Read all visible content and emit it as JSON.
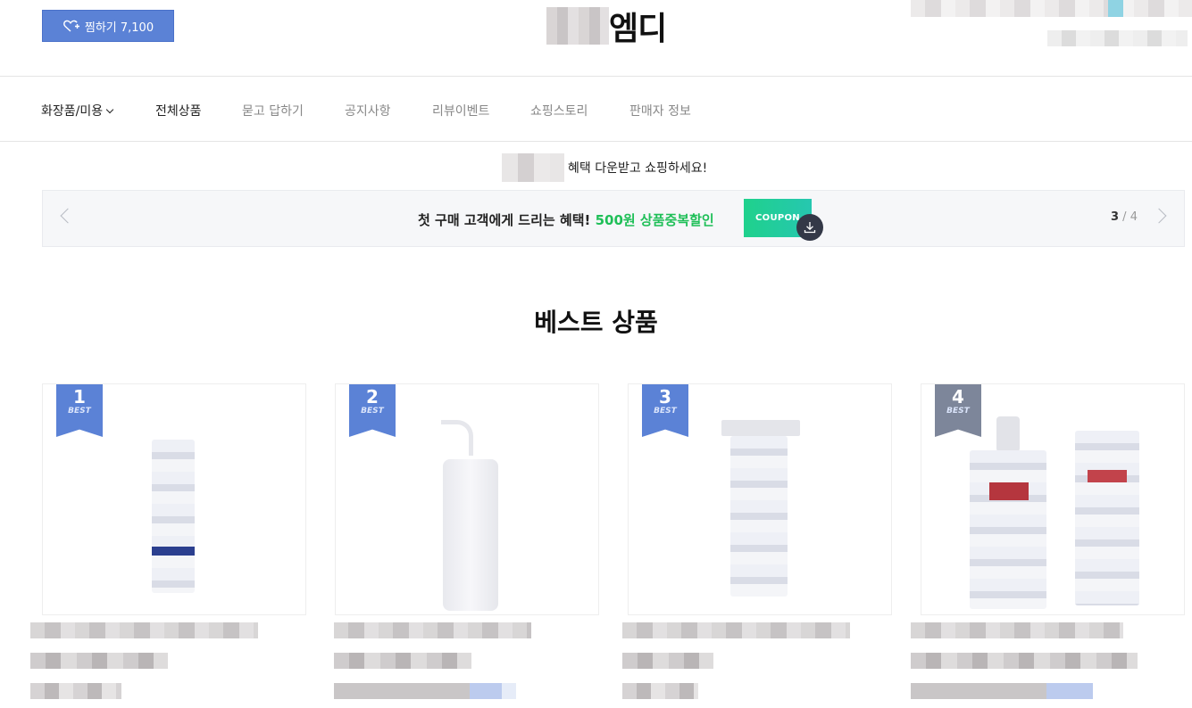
{
  "header": {
    "favorite_label": "찜하기 7,100",
    "logo_suffix": "엠디"
  },
  "nav": {
    "items": [
      {
        "label": "화장품/미용"
      },
      {
        "label": "전체상품"
      },
      {
        "label": "묻고 답하기"
      },
      {
        "label": "공지사항"
      },
      {
        "label": "리뷰이벤트"
      },
      {
        "label": "쇼핑스토리"
      },
      {
        "label": "판매자 정보"
      }
    ]
  },
  "benefit": {
    "text": "혜택 다운받고 쇼핑하세요!"
  },
  "banner": {
    "text_main": "첫 구매 고객에게 드리는 혜택!",
    "text_highlight": "500원 상품중복할인",
    "coupon_label": "COUPON",
    "page_current": "3",
    "page_separator": " / ",
    "page_total": "4",
    "highlight_color": "#1fbf58"
  },
  "section": {
    "title": "베스트 상품"
  },
  "products": [
    {
      "rank": "1",
      "badge": "BEST"
    },
    {
      "rank": "2",
      "badge": "BEST"
    },
    {
      "rank": "3",
      "badge": "BEST"
    },
    {
      "rank": "4",
      "badge": "BEST"
    }
  ],
  "colors": {
    "accent": "#5b82d6",
    "rank4": "#7d869a"
  }
}
